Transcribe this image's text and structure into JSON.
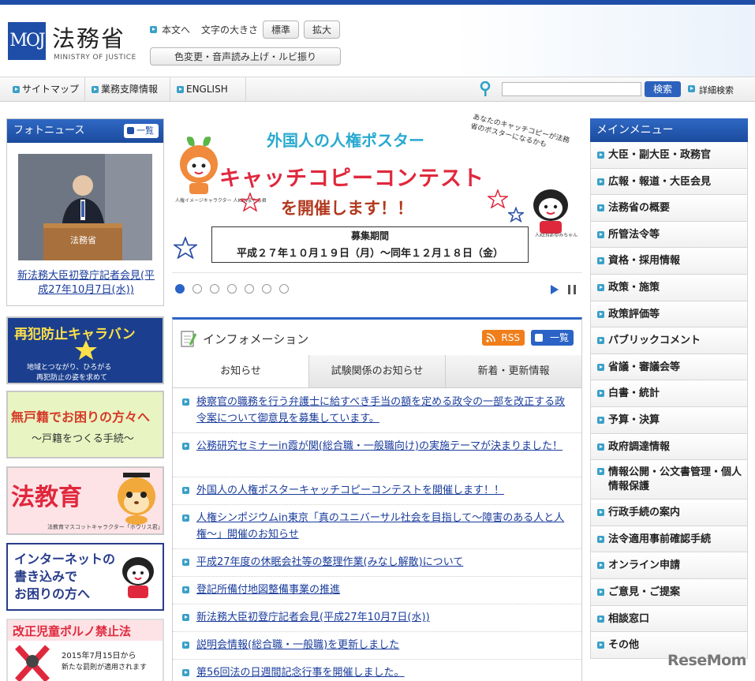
{
  "header": {
    "logo_mark": "MOJ",
    "logo_jp": "法務省",
    "logo_en": "MINISTRY OF JUSTICE",
    "skip_link": "本文へ",
    "font_size_label": "文字の大きさ",
    "font_standard": "標準",
    "font_large": "拡大",
    "accessibility": "色変更・音声読み上げ・ルビ振り"
  },
  "nav": {
    "items": [
      "サイトマップ",
      "業務支障情報",
      "ENGLISH"
    ],
    "search_placeholder": "",
    "search_button": "検索",
    "advanced_search": "詳細検索"
  },
  "photo_news": {
    "title": "フォトニュース",
    "list_button": "一覧",
    "podium_text": "法務省",
    "caption": "新法務大臣初登庁記者会見(平成27年10月7日(水))"
  },
  "banners": {
    "caravan_title": "再犯防止キャラバン",
    "caravan_sub1": "地域とつながり、ひろがる",
    "caravan_sub2": "再犯防止の姿を求めて",
    "koseki_title": "無戸籍でお困りの方々へ",
    "koseki_sub": "〜戸籍をつくる手続〜",
    "hokyoiku_title": "法教育",
    "hokyoiku_sub": "法教育マスコットキャラクター「ホウリス君」",
    "internet_title1": "インターネットの",
    "internet_title2": "書き込みで",
    "internet_title3": "お困りの方へ",
    "porno_title": "改正児童ポルノ禁止法",
    "porno_sub1": "2015年7月15日から",
    "porno_sub2": "新たな罰則が適用されます"
  },
  "hero": {
    "title1": "外国人の人権ポスター",
    "title2": "キャッチコピーコンテスト",
    "title3": "を開催します！！",
    "side_text": "あなたのキャッチコピーが法務省のポスターになるかも",
    "period_label": "募集期間",
    "period": "平成２７年１０月１９日（月）〜同年１２月１８日（金）",
    "char_left": "人権イメージキャラクター 人KENまもる君",
    "char_right": "人KENあゆみちゃん",
    "slide_count": 7,
    "active_slide": 1
  },
  "info": {
    "title": "インフォメーション",
    "rss": "RSS",
    "list_button": "一覧",
    "tabs": [
      "お知らせ",
      "試験関係のお知らせ",
      "新着・更新情報"
    ],
    "news": [
      "検察官の職務を行う弁護士に給すべき手当の額を定める政令の一部を改正する政令案について御意見を募集しています。",
      "公務研究セミナーin霞が関(総合職・一般職向け)の実施テーマが決まりました！",
      "外国人の人権ポスターキャッチコピーコンテストを開催します！！",
      "人権シンポジウムin東京「真のユニバーサル社会を目指して〜障害のある人と人権〜」開催のお知らせ",
      "平成27年度の休眠会社等の整理作業(みなし解散)について",
      "登記所備付地図整備事業の推進",
      "新法務大臣初登庁記者会見(平成27年10月7日(水))",
      "説明会情報(総合職・一般職)を更新しました",
      "第56回法の日週間記念行事を開催しました。"
    ]
  },
  "menu": {
    "title": "メインメニュー",
    "items": [
      "大臣・副大臣・政務官",
      "広報・報道・大臣会見",
      "法務省の概要",
      "所管法令等",
      "資格・採用情報",
      "政策・施策",
      "政策評価等",
      "パブリックコメント",
      "省議・審議会等",
      "白書・統計",
      "予算・決算",
      "政府調達情報",
      "情報公開・公文書管理・個人情報保護",
      "行政手続の案内",
      "法令適用事前確認手続",
      "オンライン申請",
      "ご意見・ご提案",
      "相談窓口",
      "その他"
    ]
  },
  "watermark": "ReseMom"
}
